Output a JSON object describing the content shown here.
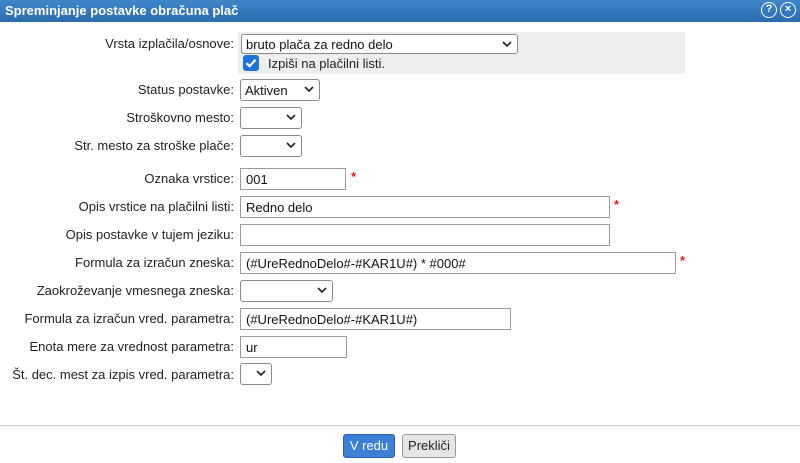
{
  "window": {
    "title": "Spreminjanje postavke obračuna plač",
    "help_icon": "help-icon",
    "close_icon": "close-icon"
  },
  "form": {
    "vrsta": {
      "label": "Vrsta izplačila/osnove:",
      "value": "bruto plača za redno delo"
    },
    "izpisi": {
      "label": "Izpiši na plačilni listi.",
      "checked": true
    },
    "status": {
      "label": "Status postavke:",
      "value": "Aktiven"
    },
    "strosek": {
      "label": "Stroškovno mesto:",
      "value": ""
    },
    "strosek_place": {
      "label": "Str. mesto za stroške plače:",
      "value": ""
    },
    "oznaka": {
      "label": "Oznaka vrstice:",
      "value": "001",
      "required": "*"
    },
    "opis": {
      "label": "Opis vrstice na plačilni listi:",
      "value": "Redno delo",
      "required": "*"
    },
    "opis_tuj": {
      "label": "Opis postavke v tujem jeziku:",
      "value": ""
    },
    "formula": {
      "label": "Formula za izračun zneska:",
      "value": "(#UreRednoDelo#-#KAR1U#) * #000#",
      "required": "*"
    },
    "zaokrozevanje": {
      "label": "Zaokroževanje vmesnega zneska:",
      "value": ""
    },
    "formula_param": {
      "label": "Formula za izračun vred. parametra:",
      "value": "(#UreRednoDelo#-#KAR1U#)"
    },
    "enota": {
      "label": "Enota mere za vrednost parametra:",
      "value": "ur"
    },
    "st_dec": {
      "label": "Št. dec. mest za izpis vred. parametra:",
      "value": ""
    }
  },
  "buttons": {
    "ok": "V redu",
    "cancel": "Prekliči"
  },
  "colors": {
    "titlebar": "#2f74b9",
    "primary_button": "#3d7fd6",
    "checkbox": "#1a73d9",
    "required": "#e02020"
  }
}
